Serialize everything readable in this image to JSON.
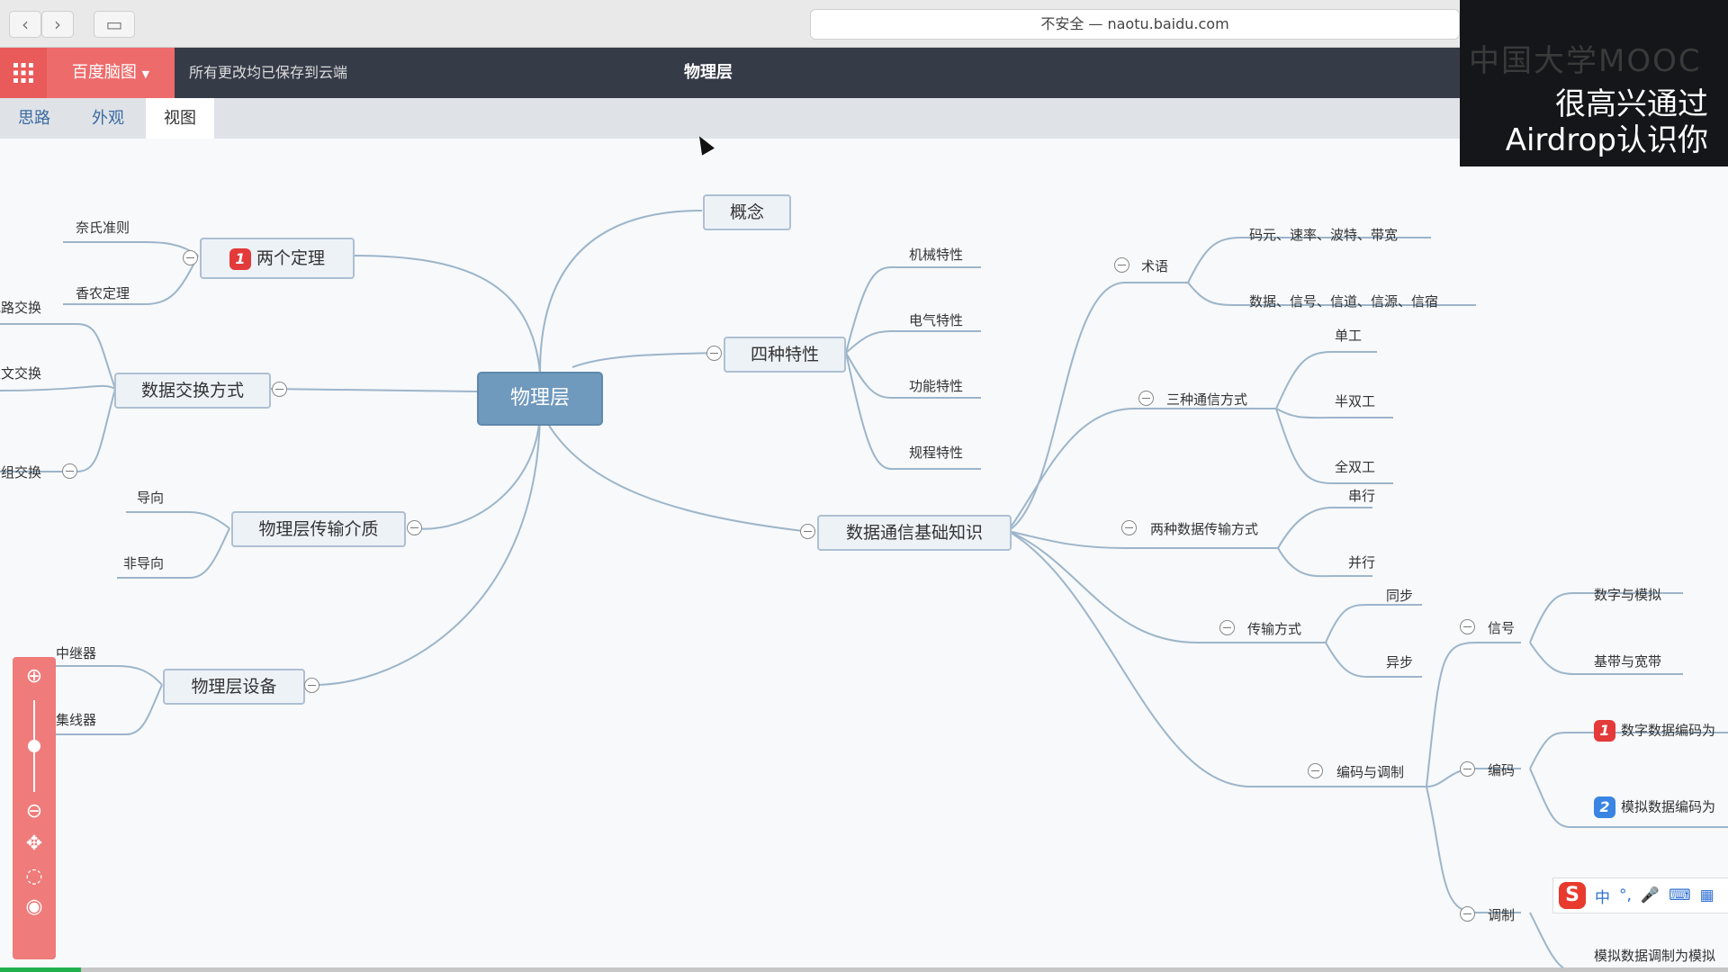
{
  "browser": {
    "address": "不安全 — naotu.baidu.com"
  },
  "header": {
    "brand": "百度脑图",
    "save_status": "所有更改均已保存到云端",
    "title": "物理层"
  },
  "tabs": [
    {
      "label": "思路"
    },
    {
      "label": "外观"
    },
    {
      "label": "视图"
    }
  ],
  "overlay": {
    "watermark": "中国大学MOOC",
    "line1": "很高兴通过",
    "line2": "Airdrop认识你"
  },
  "mindmap": {
    "root": "物理层",
    "concept": "概念",
    "theorems": {
      "label": "两个定理",
      "badge": "1",
      "children": [
        "奈氏准则",
        "香农定理"
      ]
    },
    "switching": {
      "label": "数据交换方式",
      "children": [
        "电路交换",
        "报文交换",
        "分组交换"
      ]
    },
    "medium": {
      "label": "物理层传输介质",
      "children": [
        "导向",
        "非导向"
      ]
    },
    "devices": {
      "label": "物理层设备",
      "children": [
        "中继器",
        "集线器"
      ]
    },
    "four_features": {
      "label": "四种特性",
      "children": [
        "机械特性",
        "电气特性",
        "功能特性",
        "规程特性"
      ]
    },
    "comm_basics": {
      "label": "数据通信基础知识",
      "terms": {
        "label": "术语",
        "children": [
          "码元、速率、波特、带宽",
          "数据、信号、信道、信源、信宿"
        ]
      },
      "three_modes": {
        "label": "三种通信方式",
        "children": [
          "单工",
          "半双工",
          "全双工"
        ]
      },
      "two_transfer": {
        "label": "两种数据传输方式",
        "children": [
          "串行",
          "并行"
        ]
      },
      "transmission": {
        "label": "传输方式",
        "children": [
          "同步",
          "异步"
        ]
      },
      "coding": {
        "label": "编码与调制",
        "signal": {
          "label": "信号",
          "children": [
            "数字与模拟",
            "基带与宽带"
          ]
        },
        "encoding": {
          "label": "编码",
          "children": [
            {
              "badge": "1",
              "text": "数字数据编码为"
            },
            {
              "badge": "2",
              "text": "模拟数据编码为"
            }
          ]
        },
        "modulation": {
          "label": "调制",
          "children": [
            "模拟数据调制为模拟"
          ]
        }
      }
    }
  },
  "ime": {
    "lang": "中",
    "punct": "°,",
    "mic": "🎤",
    "keyboard": "⌨",
    "grid": "▦"
  },
  "colors": {
    "header_bg": "#353b47",
    "accent": "#ee6b6b",
    "root_bg": "#6f99bd",
    "link": "#9db5c9"
  }
}
